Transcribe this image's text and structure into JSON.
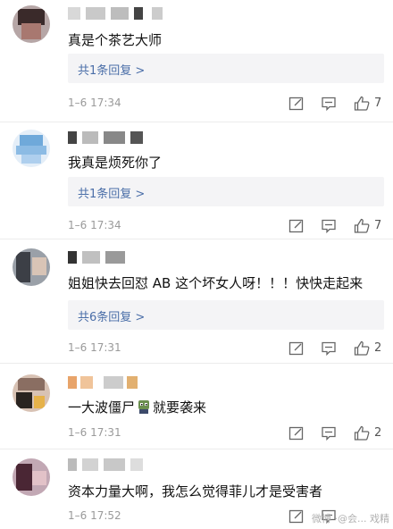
{
  "comments": [
    {
      "text": "真是个茶艺大师",
      "replies": "共1条回复 >",
      "time": "1–6 17:34",
      "likes": "7"
    },
    {
      "text": "我真是烦死你了",
      "replies": "共1条回复 >",
      "time": "1–6 17:34",
      "likes": "7"
    },
    {
      "text": "姐姐快去回怼 AB 这个坏女人呀！！！快快走起来",
      "replies": "共6条回复 >",
      "time": "1–6 17:31",
      "likes": "2"
    },
    {
      "text_before": "一大波僵尸",
      "text_after": "就要袭来",
      "time": "1–6 17:31",
      "likes": "2"
    },
    {
      "text": "资本力量大啊，我怎么觉得菲儿才是受害者",
      "time": "1–6 17:52",
      "likes": ""
    }
  ],
  "watermark": "微博 ·@会... 戏精",
  "icons": [
    "edit-icon",
    "comment-icon",
    "like-icon",
    "zombie-emoji-icon"
  ]
}
